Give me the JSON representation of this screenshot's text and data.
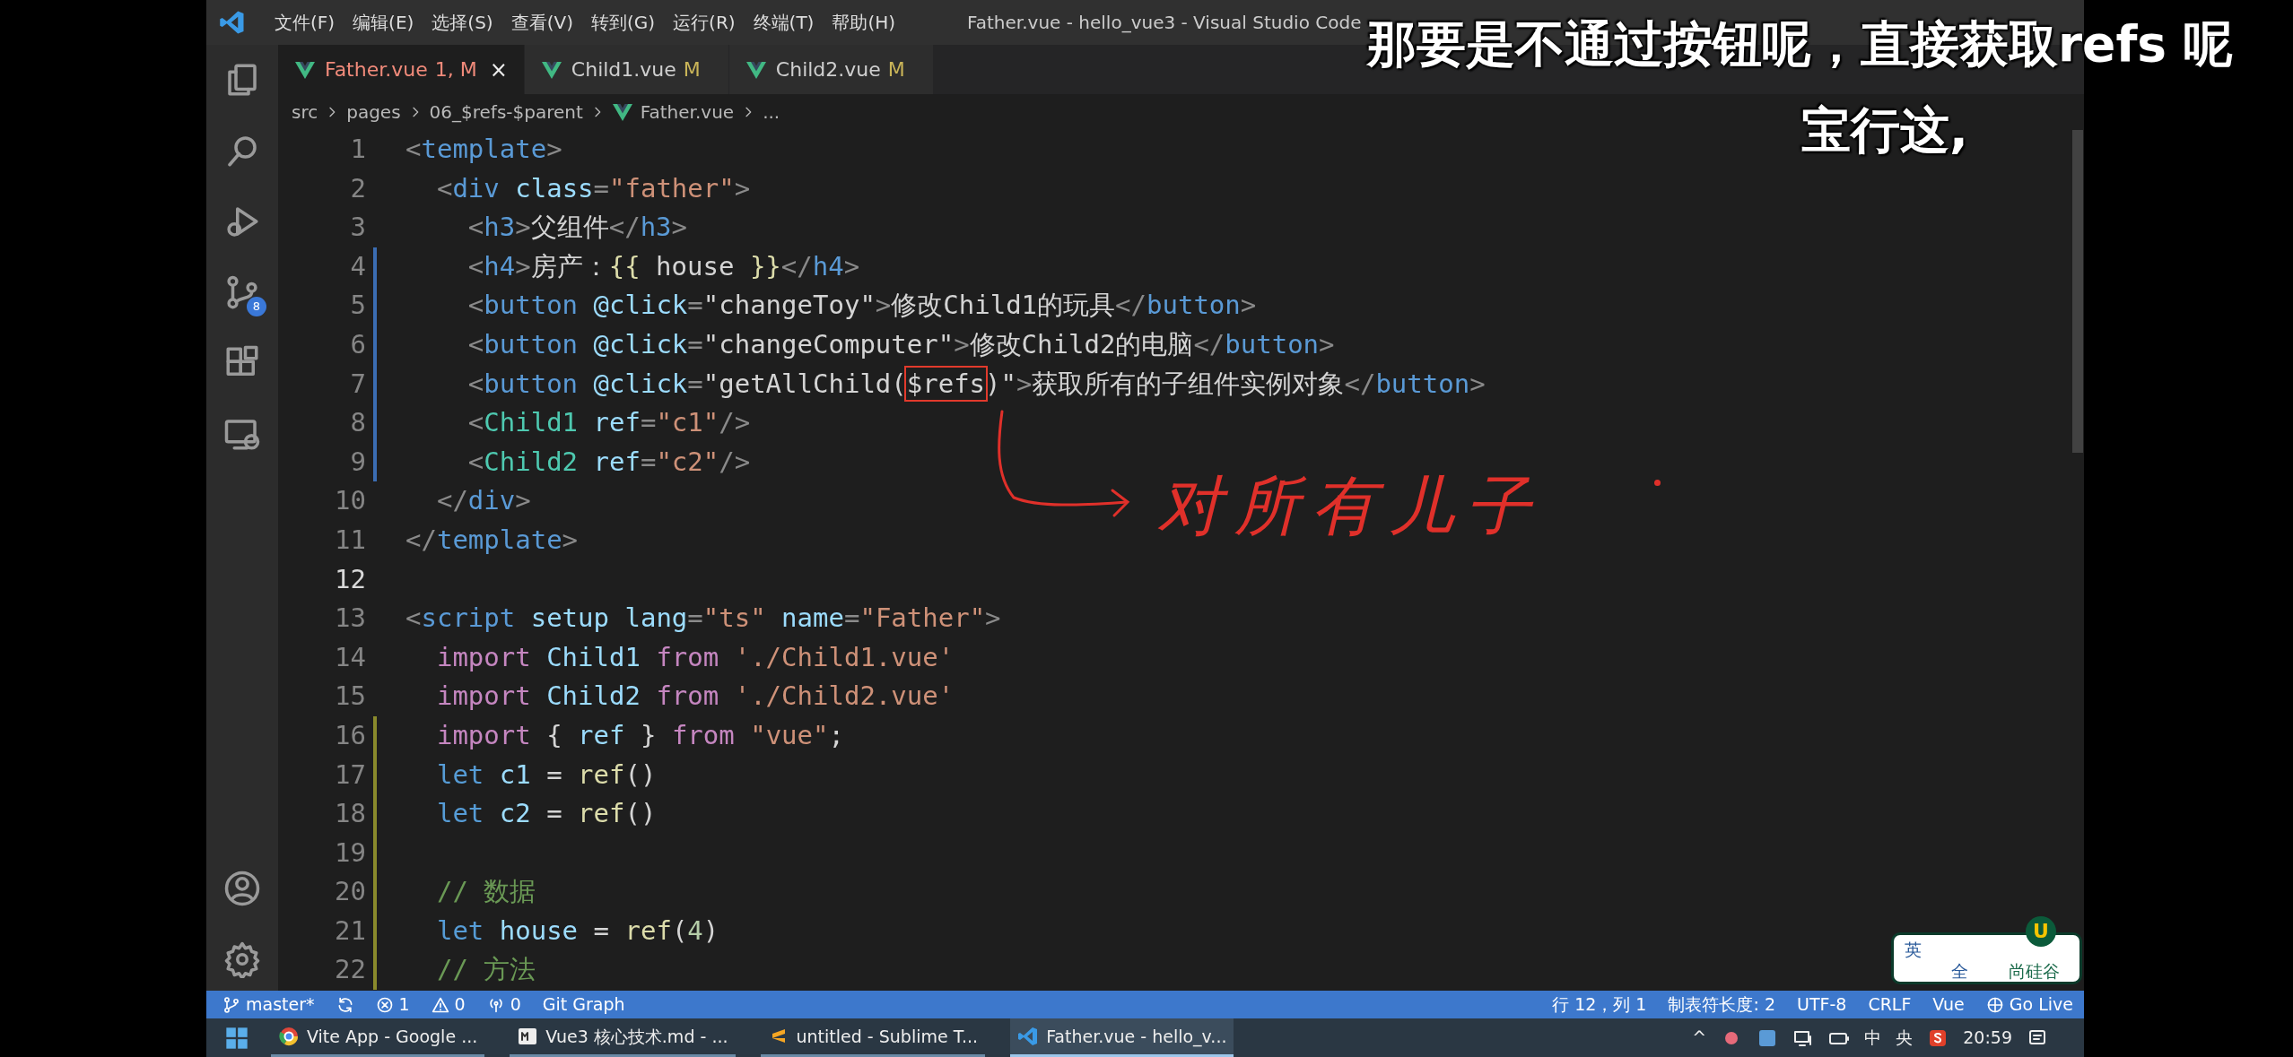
{
  "window": {
    "title": "Father.vue - hello_vue3 - Visual Studio Code"
  },
  "menu": [
    "文件(F)",
    "编辑(E)",
    "选择(S)",
    "查看(V)",
    "转到(G)",
    "运行(R)",
    "终端(T)",
    "帮助(H)"
  ],
  "activity_bar": {
    "top": [
      {
        "kind": "files"
      },
      {
        "kind": "search"
      },
      {
        "kind": "run"
      },
      {
        "kind": "source-control",
        "badge": "8"
      },
      {
        "kind": "extensions"
      },
      {
        "kind": "remote"
      }
    ],
    "bottom": [
      {
        "kind": "account"
      },
      {
        "kind": "settings"
      }
    ]
  },
  "tabs": [
    {
      "label": "Father.vue",
      "badge": "1, M",
      "error": true,
      "selected": true,
      "close": "×"
    },
    {
      "label": "Child1.vue",
      "badge": "M",
      "error": false,
      "selected": false
    },
    {
      "label": "Child2.vue",
      "badge": "M",
      "error": false,
      "selected": false
    }
  ],
  "breadcrumb": [
    {
      "label": "src",
      "kind": "folder"
    },
    {
      "label": "pages",
      "kind": "folder"
    },
    {
      "label": "06_$refs-$parent",
      "kind": "folder"
    },
    {
      "label": "Father.vue",
      "kind": "vue-file"
    },
    {
      "label": "...",
      "kind": "more"
    }
  ],
  "editor": {
    "lines": [
      {
        "number": "1",
        "current": false,
        "modified": false,
        "added": false,
        "tokens": [
          {
            "text": "<",
            "kind": "punct"
          },
          {
            "text": "template",
            "kind": "tag"
          },
          {
            "text": ">",
            "kind": "punct"
          }
        ]
      },
      {
        "number": "2",
        "current": false,
        "modified": false,
        "added": false,
        "tokens": [
          {
            "text": "  <",
            "kind": "punct"
          },
          {
            "text": "div",
            "kind": "tag"
          },
          {
            "text": " class",
            "kind": "attr"
          },
          {
            "text": "=",
            "kind": "punct"
          },
          {
            "text": "\"father\"",
            "kind": "str"
          },
          {
            "text": ">",
            "kind": "punct"
          }
        ]
      },
      {
        "number": "3",
        "current": false,
        "modified": false,
        "added": false,
        "tokens": [
          {
            "text": "    <",
            "kind": "punct"
          },
          {
            "text": "h3",
            "kind": "tag"
          },
          {
            "text": ">",
            "kind": "punct"
          },
          {
            "text": "父组件",
            "kind": "text"
          },
          {
            "text": "</",
            "kind": "punct"
          },
          {
            "text": "h3",
            "kind": "tag"
          },
          {
            "text": ">",
            "kind": "punct"
          }
        ]
      },
      {
        "number": "4",
        "current": false,
        "modified": true,
        "added": false,
        "tokens": [
          {
            "text": "    <",
            "kind": "punct"
          },
          {
            "text": "h4",
            "kind": "tag"
          },
          {
            "text": ">",
            "kind": "punct"
          },
          {
            "text": "房产：",
            "kind": "text"
          },
          {
            "text": "{{",
            "kind": "fn"
          },
          {
            "text": " house",
            "kind": "text"
          },
          {
            "text": " }}",
            "kind": "fn"
          },
          {
            "text": "</",
            "kind": "punct"
          },
          {
            "text": "h4",
            "kind": "tag"
          },
          {
            "text": ">",
            "kind": "punct"
          }
        ]
      },
      {
        "number": "5",
        "current": false,
        "modified": true,
        "added": false,
        "tokens": [
          {
            "text": "    <",
            "kind": "punct"
          },
          {
            "text": "button",
            "kind": "tag"
          },
          {
            "text": " @click",
            "kind": "attr"
          },
          {
            "text": "=",
            "kind": "punct"
          },
          {
            "text": "\"changeToy\"",
            "kind": "text"
          },
          {
            "text": ">",
            "kind": "punct"
          },
          {
            "text": "修改Child1的玩具",
            "kind": "text"
          },
          {
            "text": "</",
            "kind": "punct"
          },
          {
            "text": "button",
            "kind": "tag"
          },
          {
            "text": ">",
            "kind": "punct"
          }
        ]
      },
      {
        "number": "6",
        "current": false,
        "modified": true,
        "added": false,
        "tokens": [
          {
            "text": "    <",
            "kind": "punct"
          },
          {
            "text": "button",
            "kind": "tag"
          },
          {
            "text": " @click",
            "kind": "attr"
          },
          {
            "text": "=",
            "kind": "punct"
          },
          {
            "text": "\"changeComputer\"",
            "kind": "text"
          },
          {
            "text": ">",
            "kind": "punct"
          },
          {
            "text": "修改Child2的电脑",
            "kind": "text"
          },
          {
            "text": "</",
            "kind": "punct"
          },
          {
            "text": "button",
            "kind": "tag"
          },
          {
            "text": ">",
            "kind": "punct"
          }
        ]
      },
      {
        "number": "7",
        "current": false,
        "modified": true,
        "added": false,
        "tokens": [
          {
            "text": "    <",
            "kind": "punct"
          },
          {
            "text": "button",
            "kind": "tag"
          },
          {
            "text": " @click",
            "kind": "attr"
          },
          {
            "text": "=",
            "kind": "punct"
          },
          {
            "text": "\"getAllChild(",
            "kind": "text"
          },
          {
            "text": "$refs",
            "kind": "marked"
          },
          {
            "text": ")\"",
            "kind": "text"
          },
          {
            "text": ">",
            "kind": "punct"
          },
          {
            "text": "获取所有的子组件实例对象",
            "kind": "text"
          },
          {
            "text": "</",
            "kind": "punct"
          },
          {
            "text": "button",
            "kind": "tag"
          },
          {
            "text": ">",
            "kind": "punct"
          }
        ]
      },
      {
        "number": "8",
        "current": false,
        "modified": true,
        "added": false,
        "tokens": [
          {
            "text": "    <",
            "kind": "punct"
          },
          {
            "text": "Child1",
            "kind": "comp"
          },
          {
            "text": " ref",
            "kind": "attr"
          },
          {
            "text": "=",
            "kind": "punct"
          },
          {
            "text": "\"c1\"",
            "kind": "str"
          },
          {
            "text": "/>",
            "kind": "punct"
          }
        ]
      },
      {
        "number": "9",
        "current": false,
        "modified": true,
        "added": false,
        "tokens": [
          {
            "text": "    <",
            "kind": "punct"
          },
          {
            "text": "Child2",
            "kind": "comp"
          },
          {
            "text": " ref",
            "kind": "attr"
          },
          {
            "text": "=",
            "kind": "punct"
          },
          {
            "text": "\"c2\"",
            "kind": "str"
          },
          {
            "text": "/>",
            "kind": "punct"
          }
        ]
      },
      {
        "number": "10",
        "current": false,
        "modified": false,
        "added": false,
        "tokens": [
          {
            "text": "  </",
            "kind": "punct"
          },
          {
            "text": "div",
            "kind": "tag"
          },
          {
            "text": ">",
            "kind": "punct"
          }
        ]
      },
      {
        "number": "11",
        "current": false,
        "modified": false,
        "added": false,
        "tokens": [
          {
            "text": "</",
            "kind": "punct"
          },
          {
            "text": "template",
            "kind": "tag"
          },
          {
            "text": ">",
            "kind": "punct"
          }
        ]
      },
      {
        "number": "12",
        "current": true,
        "modified": false,
        "added": false
      },
      {
        "number": "13",
        "current": false,
        "modified": false,
        "added": false,
        "tokens": [
          {
            "text": "<",
            "kind": "punct"
          },
          {
            "text": "script",
            "kind": "tag"
          },
          {
            "text": " setup",
            "kind": "attr"
          },
          {
            "text": " lang",
            "kind": "attr"
          },
          {
            "text": "=",
            "kind": "punct"
          },
          {
            "text": "\"ts\"",
            "kind": "str"
          },
          {
            "text": " name",
            "kind": "attr"
          },
          {
            "text": "=",
            "kind": "punct"
          },
          {
            "text": "\"Father\"",
            "kind": "str"
          },
          {
            "text": ">",
            "kind": "punct"
          }
        ]
      },
      {
        "number": "14",
        "current": false,
        "modified": false,
        "added": false,
        "tokens": [
          {
            "text": "  import",
            "kind": "kw"
          },
          {
            "text": " Child1",
            "kind": "var"
          },
          {
            "text": " from",
            "kind": "kw"
          },
          {
            "text": " './Child1.vue'",
            "kind": "str"
          }
        ]
      },
      {
        "number": "15",
        "current": false,
        "modified": false,
        "added": false,
        "tokens": [
          {
            "text": "  import",
            "kind": "kw"
          },
          {
            "text": " Child2",
            "kind": "var"
          },
          {
            "text": " from",
            "kind": "kw"
          },
          {
            "text": " './Child2.vue'",
            "kind": "str"
          }
        ]
      },
      {
        "number": "16",
        "current": false,
        "modified": false,
        "added": true,
        "tokens": [
          {
            "text": "  import",
            "kind": "kw"
          },
          {
            "text": " {",
            "kind": "text"
          },
          {
            "text": " ref",
            "kind": "var"
          },
          {
            "text": " }",
            "kind": "text"
          },
          {
            "text": " from",
            "kind": "kw"
          },
          {
            "text": " \"vue\"",
            "kind": "str"
          },
          {
            "text": ";",
            "kind": "text"
          }
        ]
      },
      {
        "number": "17",
        "current": false,
        "modified": false,
        "added": true,
        "tokens": [
          {
            "text": "  let",
            "kind": "decl"
          },
          {
            "text": " c1",
            "kind": "var"
          },
          {
            "text": " =",
            "kind": "text"
          },
          {
            "text": " ref",
            "kind": "fn"
          },
          {
            "text": "()",
            "kind": "text"
          }
        ]
      },
      {
        "number": "18",
        "current": false,
        "modified": false,
        "added": true,
        "tokens": [
          {
            "text": "  let",
            "kind": "decl"
          },
          {
            "text": " c2",
            "kind": "var"
          },
          {
            "text": " =",
            "kind": "text"
          },
          {
            "text": " ref",
            "kind": "fn"
          },
          {
            "text": "()",
            "kind": "text"
          }
        ]
      },
      {
        "number": "19",
        "current": false,
        "modified": false,
        "added": true
      },
      {
        "number": "20",
        "current": false,
        "modified": false,
        "added": true,
        "tokens": [
          {
            "text": "  // 数据",
            "kind": "comment"
          }
        ]
      },
      {
        "number": "21",
        "current": false,
        "modified": false,
        "added": true,
        "tokens": [
          {
            "text": "  let",
            "kind": "decl"
          },
          {
            "text": " house",
            "kind": "var"
          },
          {
            "text": " =",
            "kind": "text"
          },
          {
            "text": " ref",
            "kind": "fn"
          },
          {
            "text": "(",
            "kind": "text"
          },
          {
            "text": "4",
            "kind": "num"
          },
          {
            "text": ")",
            "kind": "text"
          }
        ]
      },
      {
        "number": "22",
        "current": false,
        "modified": false,
        "added": true,
        "tokens": [
          {
            "text": "  // 方法",
            "kind": "comment"
          }
        ]
      }
    ]
  },
  "annotation": {
    "text": "对所有儿子"
  },
  "subtitles": [
    "那要是不通过按钮呢，直接获取refs 呢",
    "宝行这,"
  ],
  "ime_widget": {
    "language": "英",
    "width": "全",
    "brand": "尚硅谷",
    "logo": "U"
  },
  "status_bar": {
    "left": [
      {
        "kind": "branch",
        "text": "master*"
      },
      {
        "kind": "sync"
      },
      {
        "kind": "errors",
        "text": "1"
      },
      {
        "kind": "warnings",
        "text": "0"
      },
      {
        "kind": "ports",
        "text": "0"
      },
      {
        "kind": "plain",
        "text": "Git Graph"
      }
    ],
    "right": [
      {
        "kind": "plain",
        "text": "行 12，列 1"
      },
      {
        "kind": "plain",
        "text": "制表符长度: 2"
      },
      {
        "kind": "plain",
        "text": "UTF-8"
      },
      {
        "kind": "plain",
        "text": "CRLF"
      },
      {
        "kind": "plain",
        "text": "Vue"
      },
      {
        "kind": "golive",
        "text": "Go Live"
      }
    ]
  },
  "taskbar": {
    "apps": [
      {
        "kind": "chrome",
        "label": "Vite App - Google ...",
        "selected": false
      },
      {
        "kind": "markdown",
        "label": "Vue3 核心技术.md - ...",
        "selected": false
      },
      {
        "kind": "sublime",
        "label": "untitled - Sublime T...",
        "selected": false
      },
      {
        "kind": "vscode",
        "label": "Father.vue - hello_v...",
        "selected": true
      }
    ],
    "tray": {
      "chevron": "^",
      "ime": "中",
      "ime_mode": "央",
      "time": "20:59"
    }
  }
}
